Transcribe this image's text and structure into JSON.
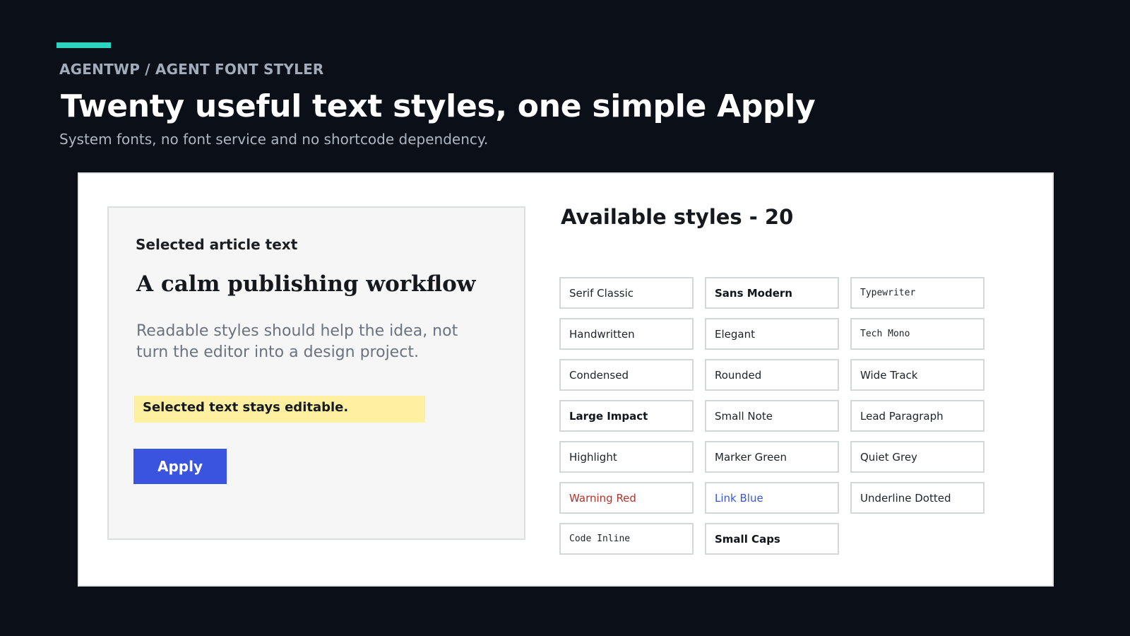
{
  "header": {
    "breadcrumb": "AGENTWP / AGENT FONT STYLER",
    "title": "Twenty useful text styles, one simple Apply",
    "subtitle": "System fonts, no font service and no shortcode dependency."
  },
  "preview": {
    "label": "Selected article text",
    "title": "A calm publishing workflow",
    "body": "Readable styles should help the idea, not turn the editor into a design project.",
    "highlight": "Selected text stays editable.",
    "apply_label": "Apply"
  },
  "styles": {
    "heading": "Available styles - 20",
    "items": [
      {
        "label": "Serif Classic"
      },
      {
        "label": "Sans Modern"
      },
      {
        "label": "Typewriter"
      },
      {
        "label": "Handwritten"
      },
      {
        "label": "Elegant"
      },
      {
        "label": "Tech Mono"
      },
      {
        "label": "Condensed"
      },
      {
        "label": "Rounded"
      },
      {
        "label": "Wide Track"
      },
      {
        "label": "Large Impact"
      },
      {
        "label": "Small Note"
      },
      {
        "label": "Lead Paragraph"
      },
      {
        "label": "Highlight"
      },
      {
        "label": "Marker Green"
      },
      {
        "label": "Quiet Grey"
      },
      {
        "label": "Warning Red"
      },
      {
        "label": "Link Blue"
      },
      {
        "label": "Underline Dotted"
      },
      {
        "label": "Code Inline"
      },
      {
        "label": "Small Caps"
      }
    ]
  },
  "colors": {
    "background": "#0b0f17",
    "accent": "#2dd4bf",
    "apply_button": "#3a54e0",
    "highlight": "#fdf0a1",
    "warning": "#b3322b",
    "link": "#3a54e0"
  }
}
